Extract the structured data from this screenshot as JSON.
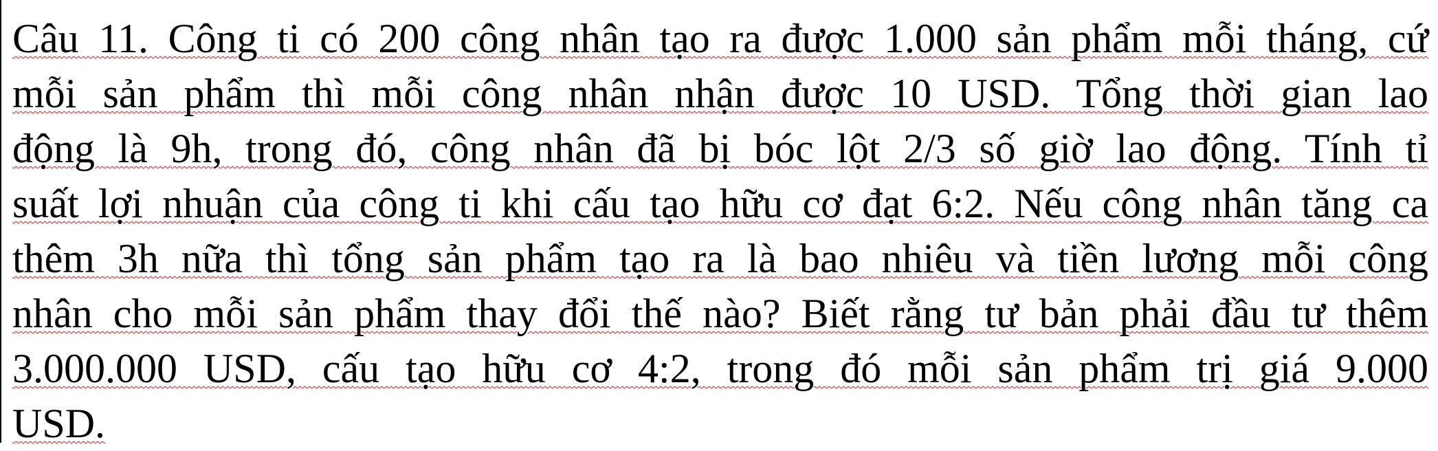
{
  "document": {
    "lines": [
      "Câu 11. Công ti có 200 công nhân tạo ra được 1.000 sản phẩm mỗi tháng, cứ",
      "mỗi sản phẩm thì mỗi công nhân nhận được 10 USD. Tổng thời gian lao",
      "động là 9h, trong đó, công nhân đã bị bóc lột 2/3 số giờ lao động. Tính tỉ",
      "suất lợi nhuận của công ti khi cấu tạo hữu cơ đạt 6:2. Nếu công nhân tăng ca",
      "thêm 3h nữa thì tổng sản phẩm tạo ra là bao nhiêu và tiền lương mỗi công",
      "nhân cho mỗi sản phẩm thay đổi thế nào? Biết rằng tư bản phải đầu tư thêm",
      "3.000.000 USD, cấu tạo hữu cơ 4:2, trong đó mỗi sản phẩm trị giá 9.000",
      "USD."
    ],
    "spellcheck_underline_color": "#d11a1a"
  }
}
